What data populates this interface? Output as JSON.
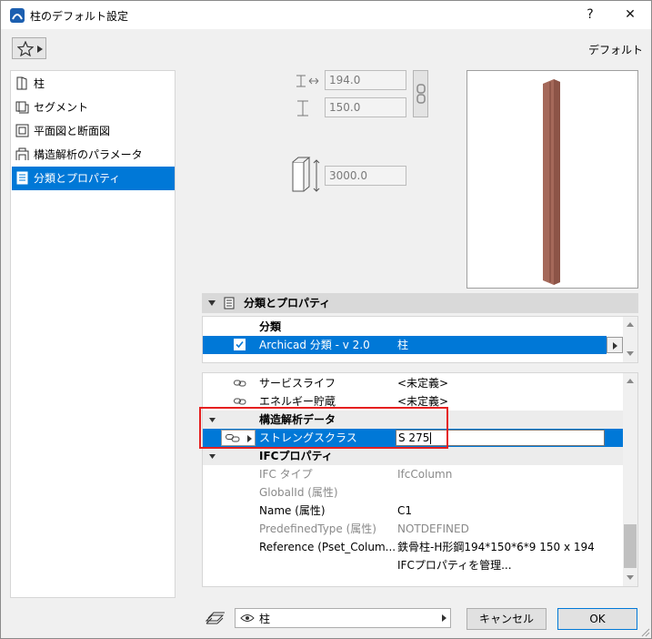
{
  "window": {
    "title": "柱のデフォルト設定",
    "help_label": "?",
    "close_label": "✕"
  },
  "header": {
    "favorites_icon": "star-icon",
    "default_label": "デフォルト"
  },
  "sidebar": {
    "items": [
      {
        "label": "柱",
        "icon": "column-icon"
      },
      {
        "label": "セグメント",
        "icon": "segment-icon"
      },
      {
        "label": "平面図と断面図",
        "icon": "floorplan-section-icon"
      },
      {
        "label": "構造解析のパラメータ",
        "icon": "structural-analysis-icon"
      },
      {
        "label": "分類とプロパティ",
        "icon": "classification-icon",
        "selected": true
      }
    ]
  },
  "geometry": {
    "width": "194.0",
    "depth": "150.0",
    "height": "3000.0"
  },
  "section": {
    "title": "分類とプロパティ"
  },
  "classification": {
    "group_label": "分類",
    "row": {
      "checked": true,
      "name": "Archicad 分類 - v 2.0",
      "value": "柱"
    }
  },
  "properties": {
    "rows": [
      {
        "name": "サービスライフ",
        "value": "<未定義>",
        "type": "linked"
      },
      {
        "name": "エネルギー貯蔵",
        "value": "<未定義>",
        "type": "linked"
      },
      {
        "name": "構造解析データ",
        "value": "",
        "type": "group"
      },
      {
        "name": "ストレングスクラス",
        "value": "S 275",
        "type": "selected"
      },
      {
        "name": "IFCプロパティ",
        "value": "",
        "type": "group"
      },
      {
        "name": "IFC タイプ",
        "value": "IfcColumn",
        "type": "disabled"
      },
      {
        "name": "GlobalId (属性)",
        "value": "",
        "type": "disabled"
      },
      {
        "name": "Name (属性)",
        "value": "C1",
        "type": "normal"
      },
      {
        "name": "PredefinedType (属性)",
        "value": "NOTDEFINED",
        "type": "disabled"
      },
      {
        "name": "Reference (Pset_Colum...",
        "value": "鉄骨柱-H形鋼194*150*6*9 150 x 194",
        "type": "normal"
      },
      {
        "name": "",
        "value": "IFCプロパティを管理...",
        "type": "normal"
      }
    ]
  },
  "footer": {
    "layer_label": "柱",
    "cancel_label": "キャンセル",
    "ok_label": "OK"
  },
  "colors": {
    "accent": "#0078d7",
    "highlight_box": "#e52020",
    "column_fill": "#a5695a"
  }
}
